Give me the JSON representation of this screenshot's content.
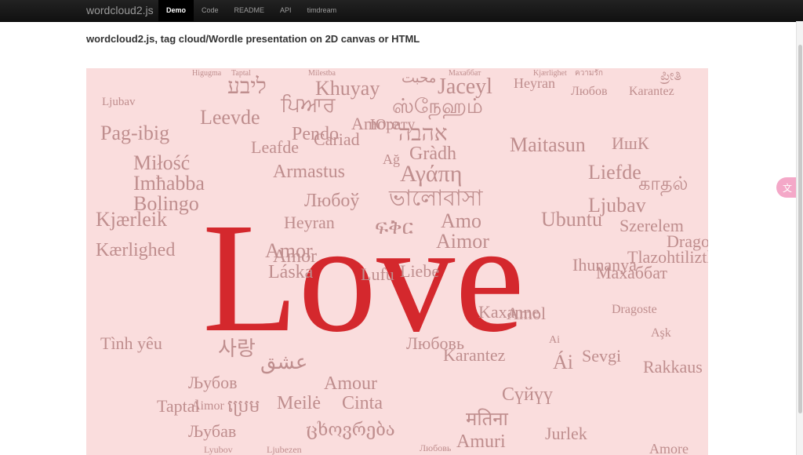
{
  "navbar": {
    "brand": "wordcloud2.js",
    "items": [
      {
        "label": "Demo",
        "active": true
      },
      {
        "label": "Code",
        "active": false
      },
      {
        "label": "README",
        "active": false
      },
      {
        "label": "API",
        "active": false
      },
      {
        "label": "timdream",
        "active": false
      }
    ]
  },
  "header": {
    "title_bold": "wordcloud2.js",
    "title_rest": ", tag cloud/Wordle presentation on 2D canvas or HTML"
  },
  "cloud": {
    "background": "#fadddd",
    "main_color": "#d4282d",
    "word_color": "#bf8e8e",
    "main_word": "Love",
    "words": [
      "Higugma",
      "Taptal",
      "Milestba",
      "Махаббат",
      "Kjærlighet",
      "ความรัก",
      "ಪ್ರೀತಿ",
      "ליבע",
      "Khuyay",
      "محبت",
      "Jaceyl",
      "Heyran",
      "Любов",
      "Karantez",
      "Ljubav",
      "ਪਿਆਰ",
      "ஸ்நேஹம்",
      "Leevde",
      "אהבה",
      "Gràdh",
      "Pendo",
      "Amore",
      "Юрату",
      "Cariad",
      "Amor",
      "Ağ",
      "Αγάπη",
      "Pag-ibig",
      "Miłość",
      "Imħabba",
      "Armastus",
      "Leafde",
      "Bolingo",
      "Любоў",
      "ভালোবাসা",
      "Ljubav",
      "Maitasun",
      "ИшК",
      "Liefde",
      "காதல்",
      "Kjærleik",
      "Heyran",
      "ፍቅር",
      "Amo",
      "Aimor",
      "Ubuntu",
      "Szerelem",
      "Tlazohtiliztli",
      "Dragoste",
      "Kærlighed",
      "Láska",
      "Amor",
      "Liebe",
      "Lufu",
      "Махаббат",
      "Ihunanya",
      "Kaxanne",
      "Amol",
      "Sevgi",
      "Ái",
      "Любовь",
      "Tình yêu",
      "Taptal",
      "사랑",
      "عشق",
      "Љубов",
      "Amour",
      "Aimor",
      "ប្រេម",
      "Meilė",
      "Cinta",
      "Karantez",
      "Rakkaus",
      "Сүйүү",
      "Љубав",
      "ცხოვრება",
      "मतिना",
      "Amuri",
      "Amore",
      "Jurlek",
      "Lyubov",
      "Ljubezen",
      "Любовь",
      "Dragoste",
      "Aşk",
      "Ai",
      "Ihunanya"
    ]
  }
}
